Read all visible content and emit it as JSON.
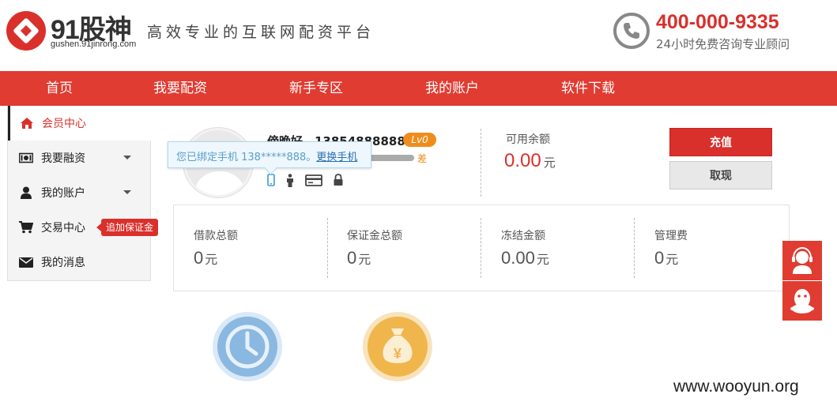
{
  "header": {
    "logo_text": "91股神",
    "logo_url": "gushen.91jinrong.com",
    "slogan": "高效专业的互联网配资平台",
    "hotline": "400-000-9335",
    "hotline_sub": "24小时免费咨询专业顾问"
  },
  "nav": {
    "items": [
      "首页",
      "我要配资",
      "新手专区",
      "我的账户",
      "软件下载"
    ]
  },
  "sidebar": {
    "items": [
      {
        "label": "会员中心",
        "icon": "home-icon",
        "active": true
      },
      {
        "label": "我要融资",
        "icon": "money-icon",
        "caret": true
      },
      {
        "label": "我的账户",
        "icon": "user-icon",
        "caret": true
      },
      {
        "label": "交易中心",
        "icon": "cart-icon"
      },
      {
        "label": "我的消息",
        "icon": "envelope-icon"
      }
    ],
    "tag": "追加保证金"
  },
  "profile": {
    "username": "傍晚好，13854888888",
    "level": "Lv0",
    "strength": "差",
    "tooltip_text": "您已绑定手机 138*****888。",
    "tooltip_link": "更换手机"
  },
  "balance": {
    "label": "可用余额",
    "value": "0.00",
    "unit": "元",
    "recharge": "充值",
    "withdraw": "取现"
  },
  "stats": [
    {
      "label": "借款总额",
      "value": "0",
      "unit": "元"
    },
    {
      "label": "保证金总额",
      "value": "0",
      "unit": "元"
    },
    {
      "label": "冻结金额",
      "value": "0.00",
      "unit": "元"
    },
    {
      "label": "管理费",
      "value": "0",
      "unit": "元"
    }
  ],
  "colors": {
    "brand_red": "#e03c32",
    "accent_orange": "#f08c1c",
    "clock_blue": "#8ab8e0",
    "moneybag_gold": "#f0b64c"
  },
  "watermark": "www.wooyun.org"
}
